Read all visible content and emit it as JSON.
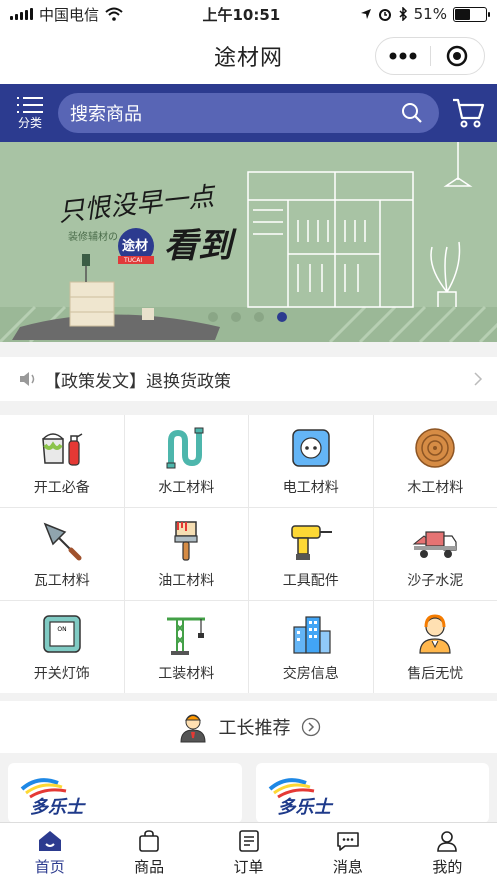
{
  "status_bar": {
    "carrier": "中国电信",
    "time": "上午10:51",
    "battery": "51%",
    "battery_level": 0.51
  },
  "title_bar": {
    "title": "途材网",
    "more_icon": "more-dots-icon",
    "close_icon": "target-circle-icon"
  },
  "search_bar": {
    "category_label": "分类",
    "placeholder": "搜索商品",
    "cart_icon": "cart-icon"
  },
  "banner": {
    "headline_1": "只恨没早一点",
    "headline_2": "看到",
    "tagline": "装修辅材の",
    "logo_text": "途材",
    "logo_sub": "TUCAI",
    "slide_count": 4,
    "active_slide": 4
  },
  "notice": {
    "text": "【政策发文】退换货政策",
    "icon": "speaker-icon"
  },
  "categories": [
    {
      "label": "开工必备",
      "icon": "paint-bucket-extinguisher-icon"
    },
    {
      "label": "水工材料",
      "icon": "water-pipe-icon"
    },
    {
      "label": "电工材料",
      "icon": "power-socket-icon"
    },
    {
      "label": "木工材料",
      "icon": "wood-ring-icon"
    },
    {
      "label": "瓦工材料",
      "icon": "trowel-icon"
    },
    {
      "label": "油工材料",
      "icon": "paint-brush-icon"
    },
    {
      "label": "工具配件",
      "icon": "drill-icon"
    },
    {
      "label": "沙子水泥",
      "icon": "cement-truck-icon"
    },
    {
      "label": "开关灯饰",
      "icon": "light-switch-icon"
    },
    {
      "label": "工装材料",
      "icon": "crane-icon"
    },
    {
      "label": "交房信息",
      "icon": "buildings-icon"
    },
    {
      "label": "售后无忧",
      "icon": "customer-service-icon"
    }
  ],
  "recommend": {
    "title": "工长推荐"
  },
  "brand_cards": [
    {
      "brand": "多乐士"
    },
    {
      "brand": "多乐士"
    }
  ],
  "tab_bar": [
    {
      "label": "首页",
      "icon": "home-icon",
      "active": true
    },
    {
      "label": "商品",
      "icon": "bag-icon",
      "active": false
    },
    {
      "label": "订单",
      "icon": "order-icon",
      "active": false
    },
    {
      "label": "消息",
      "icon": "message-icon",
      "active": false
    },
    {
      "label": "我的",
      "icon": "user-icon",
      "active": false
    }
  ],
  "colors": {
    "brand": "#2c3b8f",
    "banner_bg": "#a8c3a4"
  }
}
